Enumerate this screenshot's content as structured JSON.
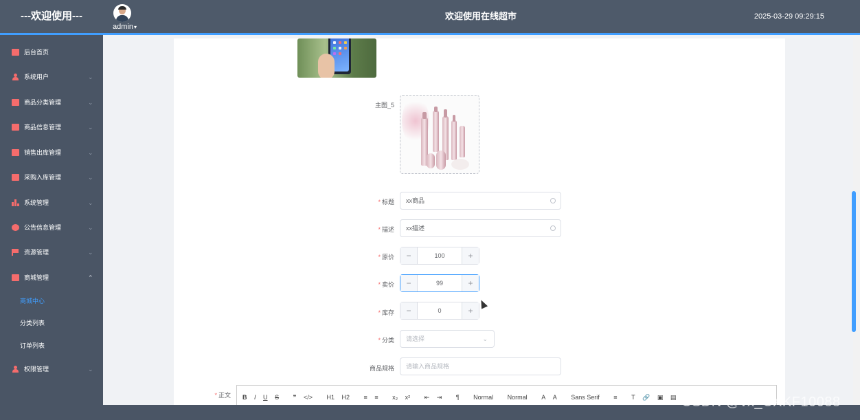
{
  "header": {
    "brand": "---欢迎使用---",
    "username": "admin",
    "title": "欢迎使用在线超市",
    "datetime": "2025-03-29 09:29:15"
  },
  "sidebar": {
    "items": [
      {
        "label": "后台首页",
        "icon": "monitor-icon"
      },
      {
        "label": "系统用户",
        "icon": "user-icon"
      },
      {
        "label": "商品分类管理",
        "icon": "chart-icon"
      },
      {
        "label": "商品信息管理",
        "icon": "chart-icon"
      },
      {
        "label": "销售出库管理",
        "icon": "chart-icon"
      },
      {
        "label": "采购入库管理",
        "icon": "chart-icon"
      },
      {
        "label": "系统管理",
        "icon": "bar-chart-icon"
      },
      {
        "label": "公告信息管理",
        "icon": "info-icon"
      },
      {
        "label": "资源管理",
        "icon": "flag-icon"
      },
      {
        "label": "商城管理",
        "icon": "monitor-icon"
      },
      {
        "label": "权限管理",
        "icon": "user-icon"
      }
    ],
    "subitems": [
      "商城中心",
      "分类列表",
      "订单列表"
    ]
  },
  "form": {
    "main_image_label": "主图_5",
    "title_label": "标题",
    "title_value": "xx商品",
    "desc_label": "描述",
    "desc_value": "xx描述",
    "original_price_label": "原价",
    "original_price": "100",
    "sale_price_label": "卖价",
    "sale_price": "99",
    "stock_label": "库存",
    "stock": "0",
    "category_label": "分类",
    "category_placeholder": "请选择",
    "spec_label": "商品规格",
    "spec_placeholder": "请输入商品规格",
    "content_label": "正文",
    "required_mark": "*"
  },
  "editor": {
    "tools": [
      "B",
      "I",
      "U",
      "S",
      "❞",
      "</>",
      "H1",
      "H2",
      "≡",
      "≡",
      "x₂",
      "x²",
      "⇤",
      "⇥",
      "¶",
      "Normal",
      "Normal",
      "A",
      "A",
      "Sans Serif",
      "≡",
      "T",
      "🔗",
      "▣",
      "▤"
    ]
  },
  "watermark": "CSDN @vx_CXKF10088",
  "colors": {
    "accent": "#409eff",
    "sidebar_bg": "#4a5565",
    "icon_red": "#f56c6c"
  }
}
